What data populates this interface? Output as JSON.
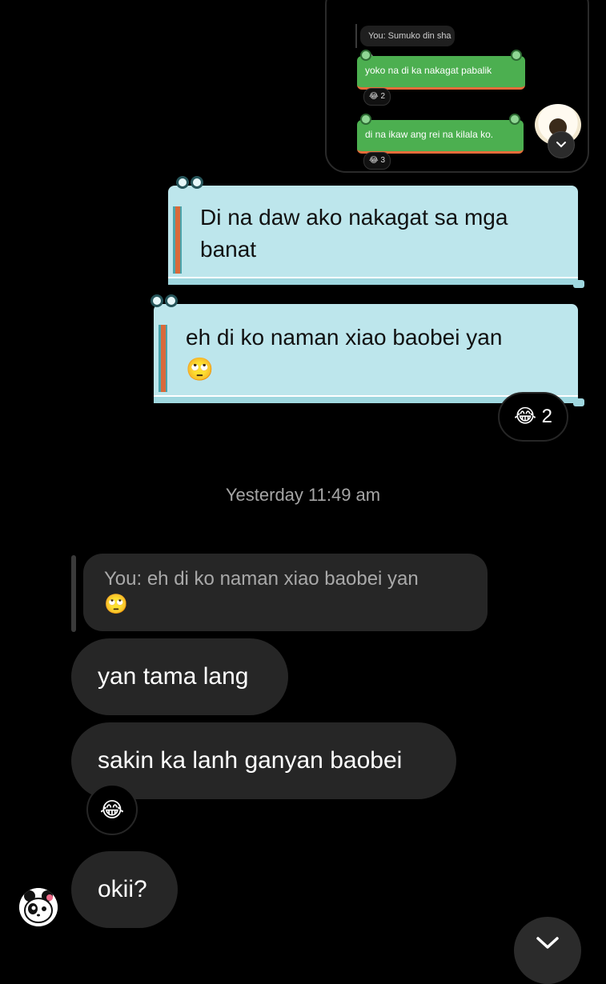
{
  "embedded_screenshot": {
    "reply_preview": "You: Sumuko din sha e",
    "messages": [
      {
        "text": "yoko na di ka nakagat pabalik",
        "reaction": "😂 2"
      },
      {
        "text": "di na ikaw ang rei na kilala ko.",
        "reaction": "😂 3"
      }
    ]
  },
  "sent_messages": [
    {
      "line1": "Di na daw ako nakagat sa mga",
      "line2": "banat"
    },
    {
      "line1": "eh di ko naman xiao baobei yan",
      "line2": "🙄",
      "reaction_emoji": "😂",
      "reaction_count": "2"
    }
  ],
  "timestamp": "Yesterday 11:49 am",
  "reply_quote": {
    "line1": "You: eh di ko naman xiao baobei yan",
    "line2": "🙄"
  },
  "received_messages": [
    {
      "text": "yan tama lang"
    },
    {
      "text": "sakin ka lanh ganyan baobei",
      "reaction": "😂"
    },
    {
      "text": "okii?"
    }
  ],
  "colors": {
    "background": "#000000",
    "received_bubble": "#262626",
    "sent_bubble_theme": "#bde6ec",
    "accent_orange": "#d9693a"
  }
}
